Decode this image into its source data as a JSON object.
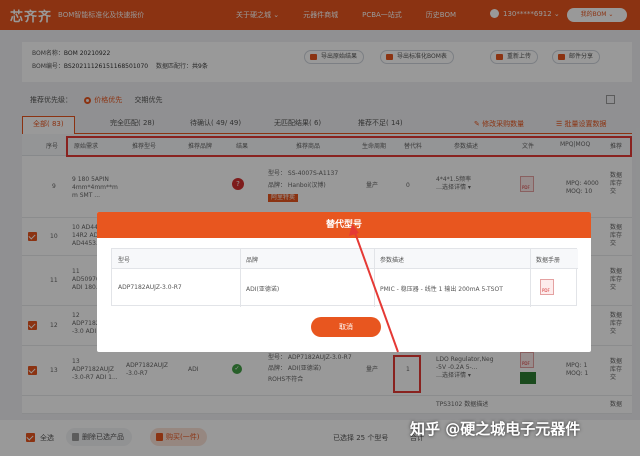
{
  "brand": {
    "logo": "芯齐齐",
    "subtitle": "BOM智能标准化及快速报价"
  },
  "nav": {
    "items": [
      "关于硬之城 ⌄",
      "元器件商城",
      "PCBA一站式",
      "历史BOM"
    ],
    "user": "130*****6912 ⌄",
    "top_button": "我的BOM ⌄"
  },
  "info": {
    "bom_name_label": "BOM名称：",
    "bom_name": "BOM 20210922",
    "bom_id_label": "BOM编号：",
    "bom_id": "BS20211126151168501070",
    "source_label": "数据匹配行：",
    "source": "共9条",
    "actions": [
      "导出原始结果",
      "导出标准化BOM表",
      "重新上传",
      "邮件分享"
    ]
  },
  "priority": {
    "label": "推荐优先级：",
    "options": [
      "价格优先",
      "交期优先"
    ]
  },
  "tabs": [
    {
      "label": "全部( 83)"
    },
    {
      "label": "完全匹配( 28)"
    },
    {
      "label": "待确认( 49/ 49)"
    },
    {
      "label": "无匹配结果( 6)"
    },
    {
      "label": "推荐不足( 14)"
    }
  ],
  "tab_actions": [
    "修改采购数量",
    "批量设置数据"
  ],
  "table": {
    "headers": [
      "序号",
      "原始需求",
      "推荐型号",
      "推荐品牌",
      "结果",
      "推荐商品",
      "生命周期",
      "替代料",
      "参数描述",
      "文件",
      "MPQ|MOQ",
      "推荐"
    ],
    "rows": [
      {
        "no": "9",
        "req": "9 180 5APIN\n4mm*4mm**m\nm SMT ...",
        "model": "",
        "brand": "",
        "product_model": "型号：  SS-4007S-A1137",
        "product_brand": "品牌：  Hanboi(汉博)",
        "tag": "阿里特卖",
        "life": "量产",
        "alt": "0",
        "param": "4*4*1.5频率\n…选择详情 ▾",
        "mpq": "MPQ: 4000\nMOQ: 10",
        "rec": "数据\n库存\n交"
      },
      {
        "no": "10",
        "req": "10 AD445\n14R2 ADI\nAD4453...",
        "rec": "数据\n库存\n交"
      },
      {
        "no": "11",
        "req": "11\nAD50970\nADI 180...",
        "rec": "数据\n库存\n交"
      },
      {
        "no": "12",
        "req": "12\nADP7182\n-3.0 ADI 1...",
        "rec": "数据\n库存\n交"
      },
      {
        "no": "13",
        "req": "13\nADP7182AUJZ\n-3.0-R7 ADI 1...",
        "model": "ADP7182AUJZ\n-3.0-R7",
        "brand": "ADI",
        "product_model": "型号：  ADP7182AUJZ-3.0-R7",
        "product_brand": "品牌：  ADI(亚德诺)",
        "tag": "ROHS不符合",
        "life": "量产",
        "alt": "1",
        "param": "LDO Regulator,Neg\n-5V -0.2A 5-...\n…选择详情 ▾",
        "mpq": "MPQ: 1\nMOQ: 1",
        "rec": "数据\n库存\n交"
      },
      {
        "no": "",
        "req": "",
        "param": "TPS3102 数据描述",
        "rec": "数据"
      }
    ]
  },
  "modal": {
    "title": "替代型号",
    "headers": [
      "型号",
      "品牌",
      "参数描述",
      "数据手册"
    ],
    "row": {
      "model": "ADP7182AUJZ-3.0-R7",
      "brand": "ADI(亚德诺)",
      "param": "PMIC - 稳压器 - 线性 1 输出 200mA 5-TSOT"
    },
    "cancel": "取消"
  },
  "bottom": {
    "select_all": "全选",
    "delete": "删除已选产品",
    "buy": "购买(一件)",
    "selected": "已选择 25 个型号",
    "total": "合计"
  },
  "watermark": "知乎 @硬之城电子元器件"
}
